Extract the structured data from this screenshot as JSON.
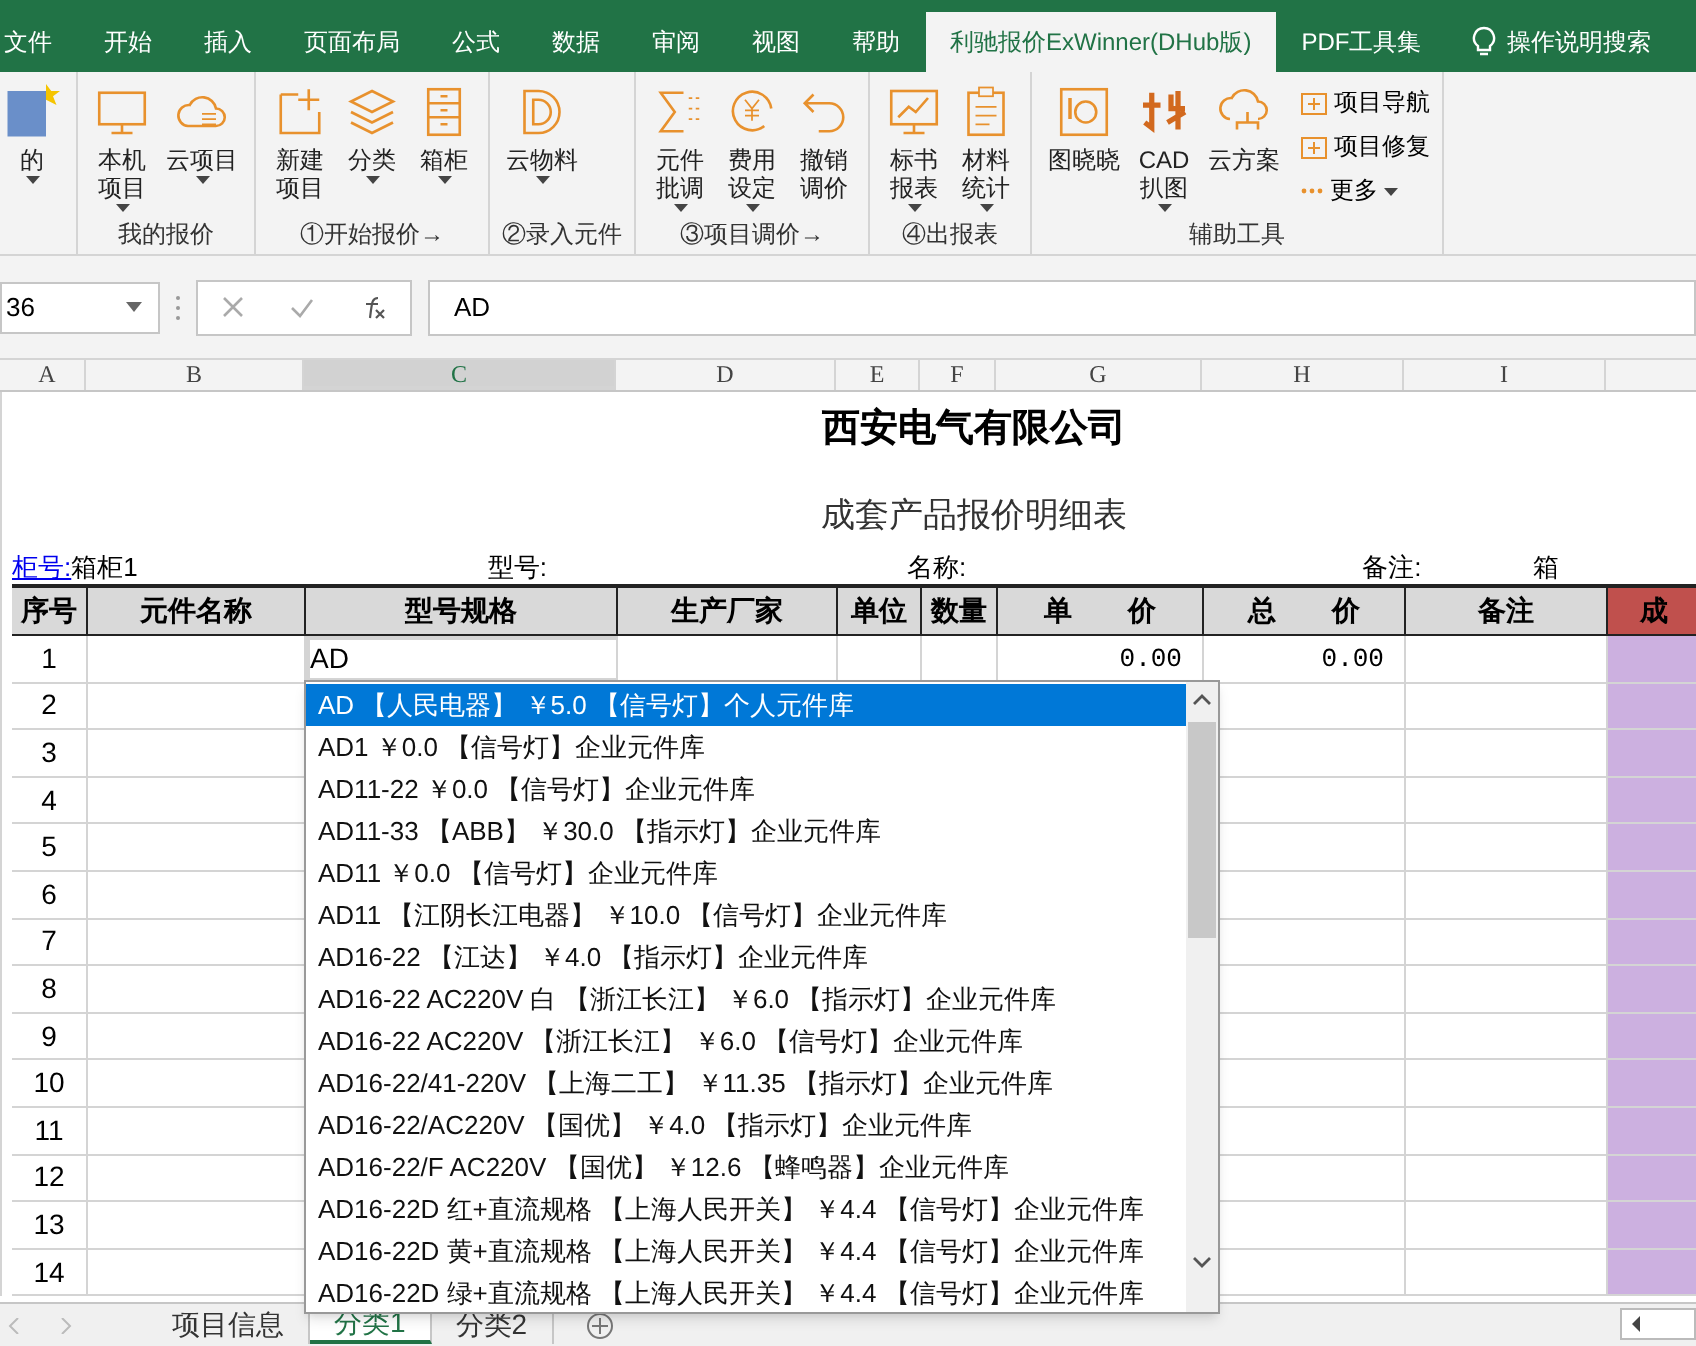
{
  "menu_tabs": [
    {
      "label": "文件",
      "selected": false
    },
    {
      "label": "开始",
      "selected": false
    },
    {
      "label": "插入",
      "selected": false
    },
    {
      "label": "页面布局",
      "selected": false
    },
    {
      "label": "公式",
      "selected": false
    },
    {
      "label": "数据",
      "selected": false
    },
    {
      "label": "审阅",
      "selected": false
    },
    {
      "label": "视图",
      "selected": false
    },
    {
      "label": "帮助",
      "selected": false
    },
    {
      "label": "利驰报价ExWinner(DHub版)",
      "selected": true
    },
    {
      "label": "PDF工具集",
      "selected": false
    }
  ],
  "tell_me": "操作说明搜索",
  "ribbon_groups": [
    {
      "buttons": [
        {
          "label": "的",
          "caret": true
        }
      ]
    },
    {
      "label": "我的报价",
      "buttons": [
        {
          "label": "本机项目",
          "caret": true
        },
        {
          "label": "云项目",
          "caret": true
        }
      ]
    },
    {
      "label": "①开始报价→",
      "buttons": [
        {
          "label": "新建项目",
          "caret": false
        },
        {
          "label": "分类",
          "caret": true
        },
        {
          "label": "箱柜",
          "caret": true
        }
      ]
    },
    {
      "label": "②录入元件",
      "buttons": [
        {
          "label": "云物料",
          "caret": true
        }
      ]
    },
    {
      "label": "③项目调价→",
      "buttons": [
        {
          "label": "元件批调",
          "caret": true
        },
        {
          "label": "费用设定",
          "caret": true
        },
        {
          "label": "撤销调价",
          "caret": false
        }
      ]
    },
    {
      "label": "④出报表",
      "buttons": [
        {
          "label": "标书报表",
          "caret": true
        },
        {
          "label": "材料统计",
          "caret": true
        }
      ]
    },
    {
      "label": "辅助工具",
      "buttons": [
        {
          "label": "图晓晓",
          "caret": false
        },
        {
          "label": "CAD扒图",
          "caret": true
        },
        {
          "label": "云方案",
          "caret": false
        }
      ],
      "small": [
        {
          "label": "项目导航",
          "caret": false
        },
        {
          "label": "项目修复",
          "caret": false
        },
        {
          "label": "更多",
          "caret": true
        }
      ]
    }
  ],
  "name_box": "36",
  "formula": "AD",
  "columns": [
    {
      "label": "A",
      "selected": false
    },
    {
      "label": "B",
      "selected": false
    },
    {
      "label": "C",
      "selected": true
    },
    {
      "label": "D",
      "selected": false
    },
    {
      "label": "E",
      "selected": false
    },
    {
      "label": "F",
      "selected": false
    },
    {
      "label": "G",
      "selected": false
    },
    {
      "label": "H",
      "selected": false
    },
    {
      "label": "I",
      "selected": false
    }
  ],
  "sheet_title": "西安电气有限公司",
  "sheet_subtitle": "成套产品报价明细表",
  "info": {
    "cabinet_link": "柜号:",
    "cabinet_value": "箱柜1",
    "model": "型号:",
    "name": "名称:",
    "note": "备注:",
    "cut": "箱"
  },
  "headers": [
    "序号",
    "元件名称",
    "型号规格",
    "生产厂家",
    "单位",
    "数量",
    "单　　价",
    "总　　价",
    "备注",
    "成"
  ],
  "rows": [
    {
      "no": "1",
      "spec": "AD",
      "unit_price": "0.00",
      "total": "0.00"
    },
    {
      "no": "2"
    },
    {
      "no": "3"
    },
    {
      "no": "4"
    },
    {
      "no": "5"
    },
    {
      "no": "6"
    },
    {
      "no": "7"
    },
    {
      "no": "8"
    },
    {
      "no": "9"
    },
    {
      "no": "10"
    },
    {
      "no": "11"
    },
    {
      "no": "12"
    },
    {
      "no": "13"
    },
    {
      "no": "14"
    }
  ],
  "suggestions": [
    {
      "text": "AD 【人民电器】 ￥5.0 【信号灯】个人元件库",
      "selected": true
    },
    {
      "text": "AD1 ￥0.0 【信号灯】企业元件库",
      "selected": false
    },
    {
      "text": "AD11-22 ￥0.0 【信号灯】企业元件库",
      "selected": false
    },
    {
      "text": "AD11-33 【ABB】 ￥30.0 【指示灯】企业元件库",
      "selected": false
    },
    {
      "text": "AD11 ￥0.0 【信号灯】企业元件库",
      "selected": false
    },
    {
      "text": "AD11 【江阴长江电器】 ￥10.0 【信号灯】企业元件库",
      "selected": false
    },
    {
      "text": "AD16-22 【江达】 ￥4.0 【指示灯】企业元件库",
      "selected": false
    },
    {
      "text": "AD16-22 AC220V 白 【浙江长江】 ￥6.0 【指示灯】企业元件库",
      "selected": false
    },
    {
      "text": "AD16-22 AC220V 【浙江长江】 ￥6.0 【信号灯】企业元件库",
      "selected": false
    },
    {
      "text": "AD16-22/41-220V 【上海二工】 ￥11.35 【指示灯】企业元件库",
      "selected": false
    },
    {
      "text": "AD16-22/AC220V 【国优】 ￥4.0 【指示灯】企业元件库",
      "selected": false
    },
    {
      "text": "AD16-22/F AC220V 【国优】 ￥12.6 【蜂鸣器】企业元件库",
      "selected": false
    },
    {
      "text": "AD16-22D 红+直流规格 【上海人民开关】 ￥4.4 【信号灯】企业元件库",
      "selected": false
    },
    {
      "text": "AD16-22D 黄+直流规格 【上海人民开关】 ￥4.4 【信号灯】企业元件库",
      "selected": false
    },
    {
      "text": "AD16-22D 绿+直流规格 【上海人民开关】 ￥4.4 【信号灯】企业元件库",
      "selected": false
    }
  ],
  "sheet_tabs": [
    {
      "label": "项目信息",
      "selected": false
    },
    {
      "label": "分类1",
      "selected": true
    },
    {
      "label": "分类2",
      "selected": false
    }
  ]
}
